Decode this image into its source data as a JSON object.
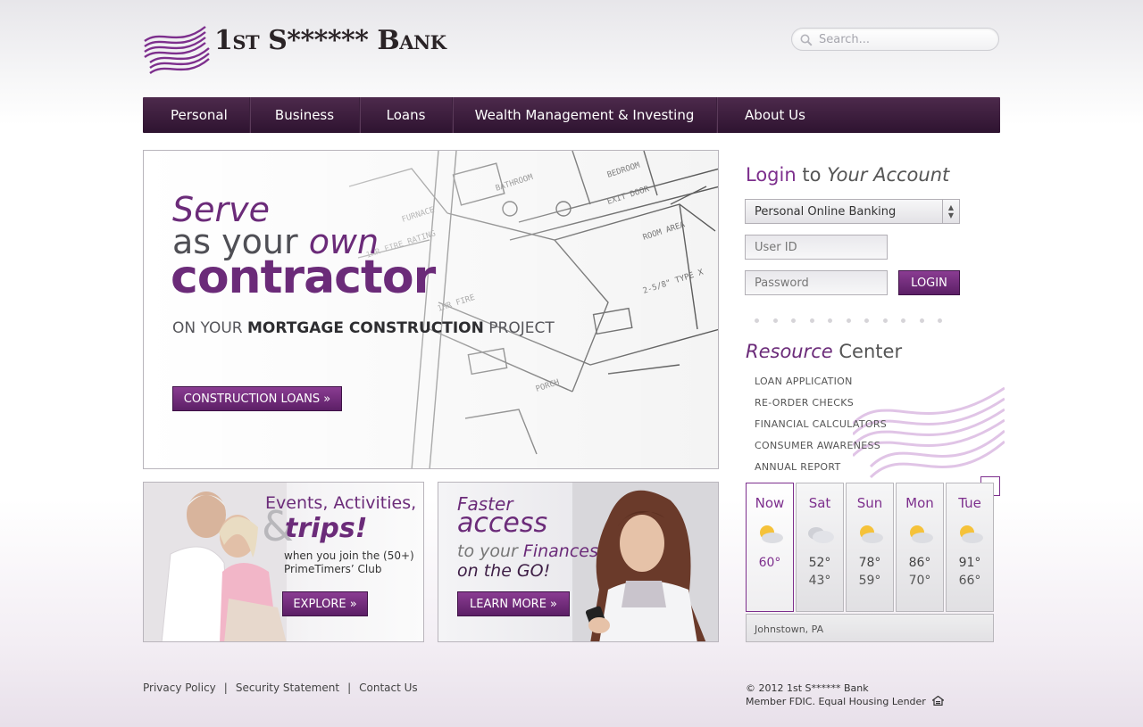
{
  "brand": {
    "name": "1st S****** Bank",
    "accent": "#6b2b79",
    "nav_bg": "#3b1f3c"
  },
  "search": {
    "placeholder": "Search..."
  },
  "nav": {
    "items": [
      {
        "label": "Personal"
      },
      {
        "label": "Business"
      },
      {
        "label": "Loans"
      },
      {
        "label": "Wealth Management & Investing"
      },
      {
        "label": "About Us"
      }
    ]
  },
  "hero": {
    "line1": "Serve",
    "line2a": "as your ",
    "line2b": "own",
    "line3": "contractor",
    "tag_a": "ON YOUR ",
    "tag_b": "MORTGAGE CONSTRUCTION",
    "tag_c": " PROJECT",
    "button": "CONSTRUCTION LOANS »"
  },
  "promo1": {
    "title1": "Events, Activities,",
    "amp": "&",
    "title2": "trips!",
    "sub1": "when you join the (50+)",
    "sub2": "PrimeTimers’ Club",
    "button": "EXPLORE »"
  },
  "promo2": {
    "line1": "Faster",
    "line2": "access",
    "line3a": "to your ",
    "line3b": "Finances",
    "line4": "on the GO!",
    "button": "LEARN MORE »"
  },
  "login": {
    "title_a": "Login",
    "title_b": " to ",
    "title_c": "Your Account",
    "account_type": "Personal Online Banking",
    "userid_placeholder": "User ID",
    "password_placeholder": "Password",
    "button": "LOGIN"
  },
  "resources": {
    "title_a": "Resource",
    "title_b": " Center",
    "items": [
      "LOAN APPLICATION",
      "RE-ORDER CHECKS",
      "FINANCIAL CALCULATORS",
      "CONSUMER AWARENESS",
      "ANNUAL REPORT"
    ]
  },
  "weather": {
    "close": "x",
    "location": "Johnstown, PA",
    "days": [
      {
        "name": "Now",
        "hi": "60°",
        "lo": "",
        "icon": "partly-sunny-icon"
      },
      {
        "name": "Sat",
        "hi": "52°",
        "lo": "43°",
        "icon": "cloudy-icon"
      },
      {
        "name": "Sun",
        "hi": "78°",
        "lo": "59°",
        "icon": "partly-sunny-icon"
      },
      {
        "name": "Mon",
        "hi": "86°",
        "lo": "70°",
        "icon": "partly-sunny-icon"
      },
      {
        "name": "Tue",
        "hi": "91°",
        "lo": "66°",
        "icon": "partly-sunny-icon"
      }
    ]
  },
  "footer": {
    "links": [
      "Privacy Policy",
      "Security Statement",
      "Contact Us"
    ],
    "separator": "|",
    "copyright": "© 2012 1st S****** Bank",
    "fdic": "Member FDIC. Equal Housing Lender"
  }
}
